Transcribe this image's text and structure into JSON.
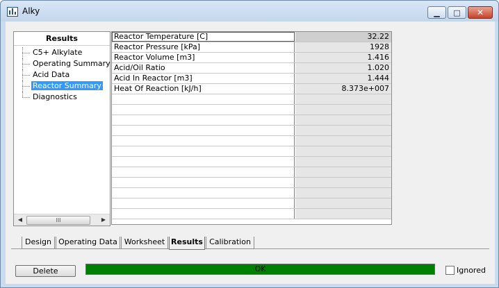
{
  "window": {
    "title": "Alky",
    "caption_buttons": {
      "minimize": "minimize-icon",
      "maximize": "maximize-icon",
      "close": "close-icon"
    }
  },
  "results_panel": {
    "header": "Results",
    "items": [
      {
        "label": "C5+ Alkylate",
        "selected": false
      },
      {
        "label": "Operating Summary",
        "selected": false
      },
      {
        "label": "Acid Data",
        "selected": false
      },
      {
        "label": "Reactor Summary",
        "selected": true
      },
      {
        "label": "Diagnostics",
        "selected": false
      }
    ],
    "scrollbar": {
      "thumb_glyph": "III"
    }
  },
  "grid": {
    "rows": [
      {
        "name": "Reactor Temperature [C]",
        "value": "32.22"
      },
      {
        "name": "Reactor Pressure [kPa]",
        "value": "1928"
      },
      {
        "name": "Reactor Volume [m3]",
        "value": "1.416"
      },
      {
        "name": "Acid/Oil Ratio",
        "value": "1.020"
      },
      {
        "name": "Acid In Reactor [m3]",
        "value": "1.444"
      },
      {
        "name": "Heat Of Reaction [kJ/h]",
        "value": "8.373e+007"
      }
    ],
    "empty_row_count": 12
  },
  "tabs": [
    {
      "label": "Design",
      "active": false
    },
    {
      "label": "Operating Data",
      "active": false
    },
    {
      "label": "Worksheet",
      "active": false
    },
    {
      "label": "Results",
      "active": true
    },
    {
      "label": "Calibration",
      "active": false
    }
  ],
  "footer": {
    "delete_label": "Delete",
    "status_text": "OK",
    "status_color": "#008000",
    "ignored_label": "Ignored",
    "ignored_checked": false
  }
}
